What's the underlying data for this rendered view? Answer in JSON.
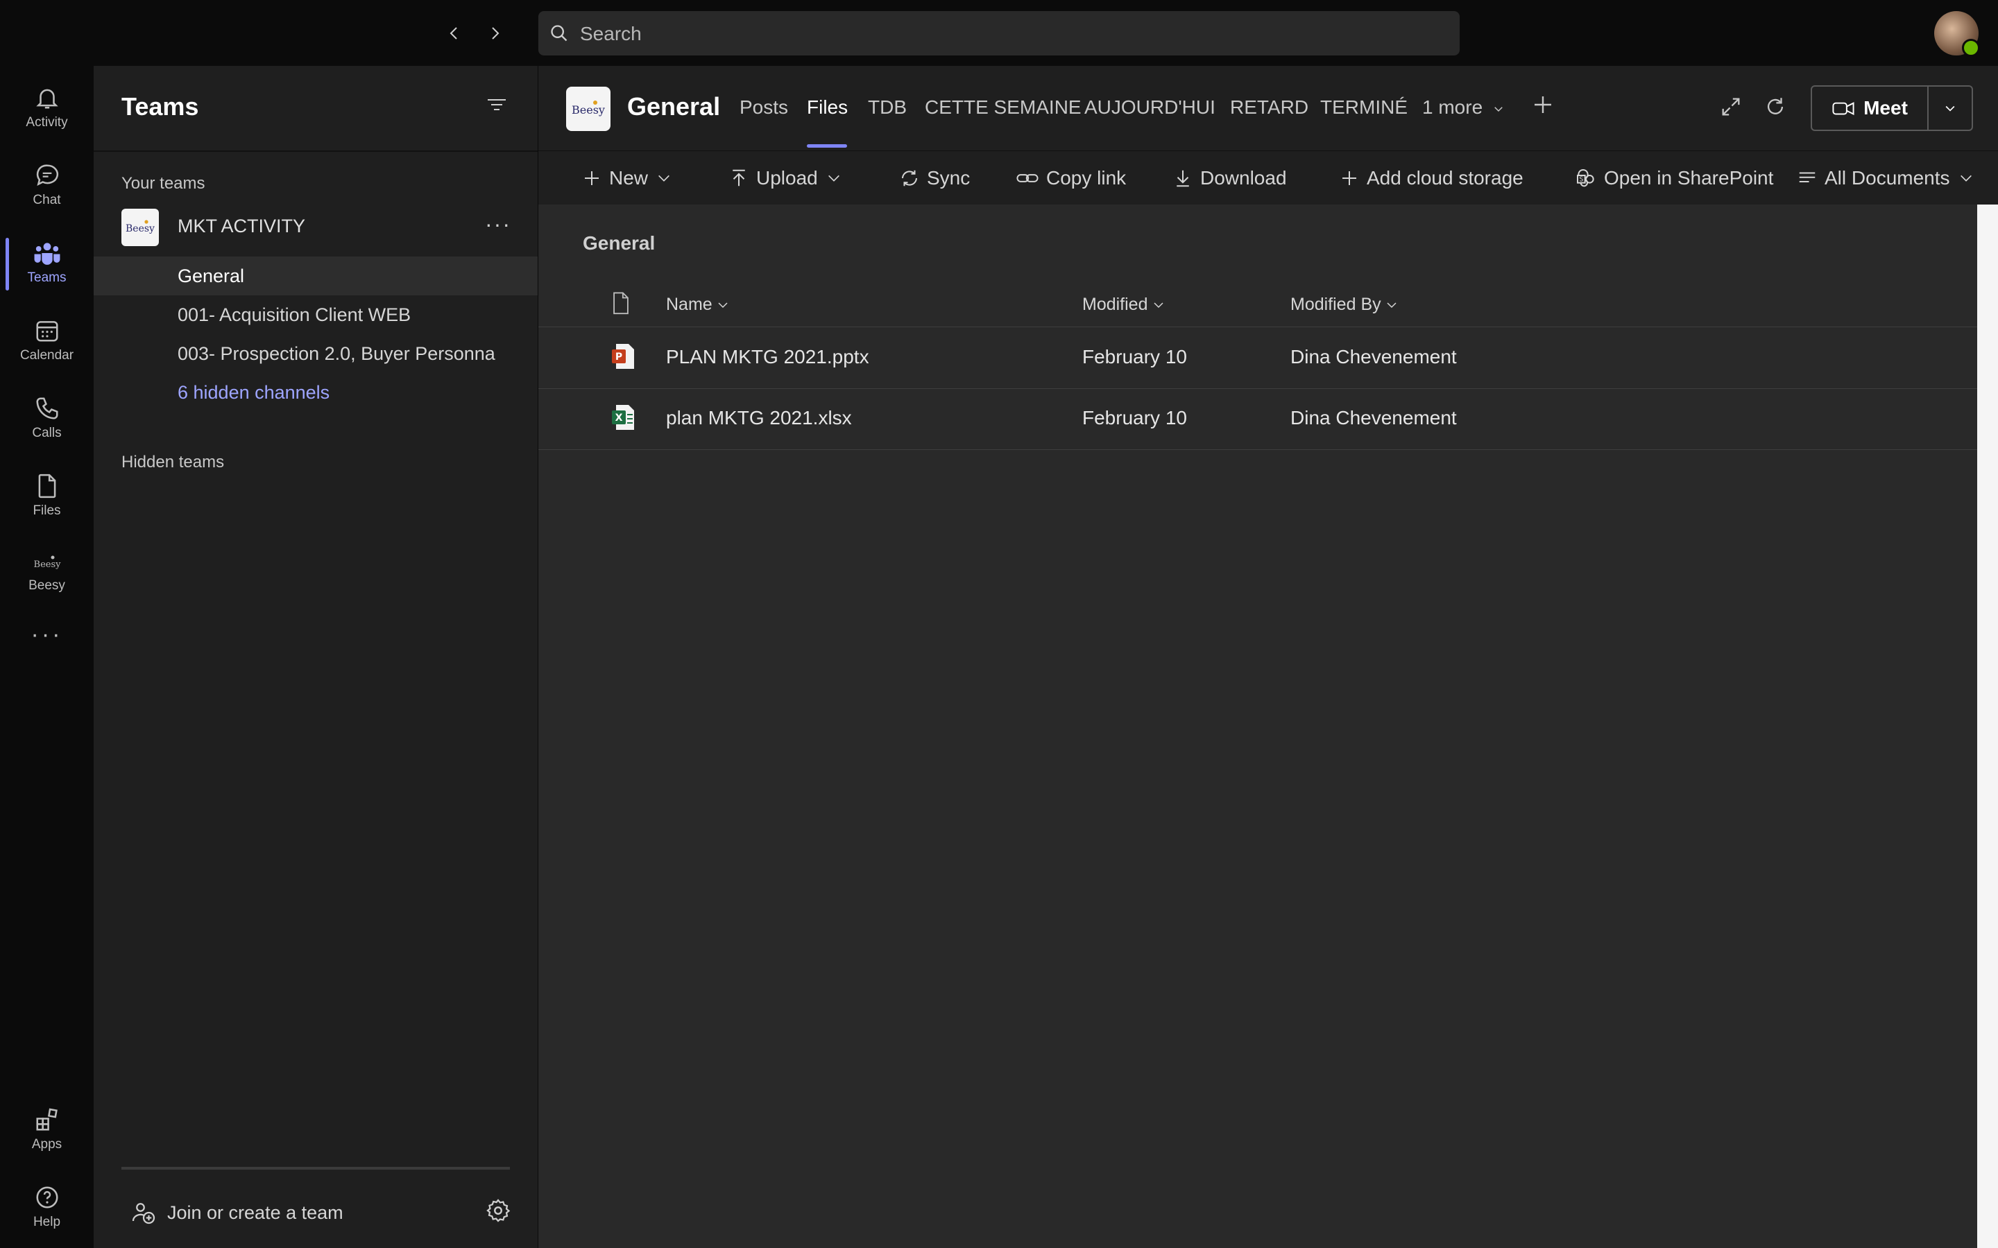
{
  "search": {
    "placeholder": "Search"
  },
  "rail": {
    "items": [
      {
        "label": "Activity",
        "icon": "bell-icon"
      },
      {
        "label": "Chat",
        "icon": "chat-icon"
      },
      {
        "label": "Teams",
        "icon": "teams-icon",
        "active": true
      },
      {
        "label": "Calendar",
        "icon": "calendar-icon"
      },
      {
        "label": "Calls",
        "icon": "phone-icon"
      },
      {
        "label": "Files",
        "icon": "file-icon"
      },
      {
        "label": "Beesy",
        "icon": "beesy-app-icon"
      }
    ],
    "bottom": [
      {
        "label": "Apps",
        "icon": "apps-icon"
      },
      {
        "label": "Help",
        "icon": "help-icon"
      }
    ]
  },
  "panel": {
    "title": "Teams",
    "your_teams": "Your teams",
    "team": {
      "name": "MKT ACTIVITY",
      "logo_text": "Beesy"
    },
    "channels": [
      {
        "label": "General",
        "active": true
      },
      {
        "label": "001- Acquisition Client WEB"
      },
      {
        "label": "003- Prospection 2.0, Buyer Personna"
      }
    ],
    "hidden_channels": "6 hidden channels",
    "hidden_teams": "Hidden teams",
    "join": "Join or create a team"
  },
  "header": {
    "logo_text": "Beesy",
    "title": "General",
    "tabs": [
      "Posts",
      "Files",
      "TDB",
      "CETTE SEMAINE",
      "AUJOURD'HUI",
      "RETARD",
      "TERMINÉ",
      "1 more"
    ],
    "active_tab": "Files",
    "meet": "Meet"
  },
  "toolbar": {
    "new": "New",
    "upload": "Upload",
    "sync": "Sync",
    "copy_link": "Copy link",
    "download": "Download",
    "add_cloud": "Add cloud storage",
    "sharepoint": "Open in SharePoint",
    "view": "All Documents"
  },
  "files": {
    "folder": "General",
    "columns": {
      "name": "Name",
      "modified": "Modified",
      "modified_by": "Modified By"
    },
    "rows": [
      {
        "name": "PLAN MKTG 2021.pptx",
        "type": "powerpoint-file-icon",
        "modified": "February 10",
        "modified_by": "Dina Chevenement"
      },
      {
        "name": "plan MKTG 2021.xlsx",
        "type": "excel-file-icon",
        "modified": "February 10",
        "modified_by": "Dina Chevenement"
      }
    ]
  },
  "colors": {
    "accent": "#7f85f5",
    "accent_text": "#9ea5ff",
    "presence": "#6bb700",
    "powerpoint": "#c43e1c",
    "excel": "#1d6f42"
  }
}
